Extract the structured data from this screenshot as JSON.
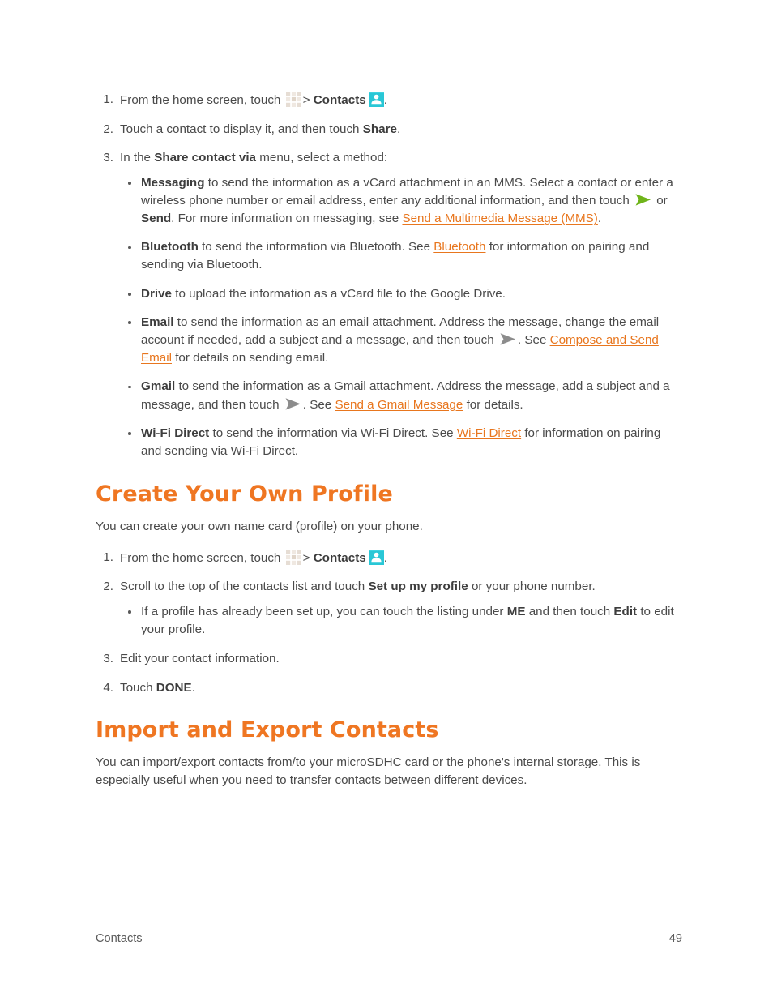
{
  "page": {
    "footer_left": "Contacts",
    "footer_page_number": "49",
    "link_color": "#e8761e",
    "heading_color": "#ef7622",
    "body_color": "#4a4a4a",
    "contacts_icon_color": "#29c7d6",
    "send_icon_green": "#6fb41a",
    "send_icon_gray": "#8c8c8c",
    "apps_icon_color": "#e3d9cf"
  },
  "share_steps": {
    "step1": {
      "number": "1.",
      "text_before_icon": "From the home screen, touch",
      "separator": ">",
      "bold_label": "Contacts",
      "text_after": "."
    },
    "step2": {
      "number": "2.",
      "text_before": "Touch a contact to display it, and then touch",
      "bold_label": "Share",
      "text_after": "."
    },
    "step3": {
      "number": "3.",
      "text_before": "In the",
      "bold_label": "Share contact via",
      "text_after": "menu, select a method:"
    }
  },
  "share_methods": [
    {
      "bold_label": "Messaging",
      "part1": " to send the information as a vCard attachment in an MMS. Select a contact or enter a wireless phone number or email address, enter any additional information, and then touch ",
      "part2": " or ",
      "bold_label2": "Send",
      "part3": ". For more information on messaging, see ",
      "link": "Send a Multimedia Message (MMS)",
      "part4": "."
    },
    {
      "bold_label": "Bluetooth",
      "part1": " to send the information via Bluetooth. See ",
      "link": "Bluetooth",
      "part2": " for information on pairing and sending via Bluetooth."
    },
    {
      "bold_label": "Drive",
      "part1": " to upload the information as a vCard file to the Google Drive."
    },
    {
      "bold_label": "Email",
      "part1": " to send the information as an email attachment. Address the message, change the email account if needed, add a subject and a message, and then touch ",
      "part2": ". See ",
      "link": "Compose and Send Email",
      "part3": " for details on sending email."
    },
    {
      "bold_label": "Gmail",
      "part1": " to send the information as a Gmail attachment. Address the message, add a subject and a message, and then touch ",
      "part2": ". See ",
      "link": "Send a Gmail Message",
      "part3": " for details."
    },
    {
      "bold_label": "Wi-Fi Direct",
      "part1": " to send the information via Wi-Fi Direct. See ",
      "link": "Wi-Fi Direct",
      "part2": " for information on pairing and sending via Wi-Fi Direct."
    }
  ],
  "create_profile": {
    "heading": "Create Your Own Profile",
    "intro": "You can create your own name card (profile) on your phone.",
    "step1": {
      "number": "1.",
      "text_before_icon": "From the home screen, touch",
      "separator": ">",
      "bold_label": "Contacts",
      "text_after": "."
    },
    "step2": {
      "number": "2.",
      "text_before": "Scroll to the top of the contacts list and touch",
      "bold_label": "Set up my profile",
      "text_after": "or your phone number."
    },
    "step2_note": {
      "part1": "If a profile has already been set up, you can touch the listing under ",
      "bold1": "ME",
      "part2": " and then touch ",
      "bold2": "Edit",
      "part3": " to edit your profile."
    },
    "step3": {
      "number": "3.",
      "text": "Edit your contact information."
    },
    "step4": {
      "number": "4.",
      "text_before": "Touch",
      "bold_label": "DONE",
      "text_after": "."
    }
  },
  "import_export": {
    "heading": "Import and Export Contacts",
    "paragraph": "You can import/export contacts from/to your microSDHC card or the phone's internal storage. This is especially useful when you need to transfer contacts between different devices."
  }
}
